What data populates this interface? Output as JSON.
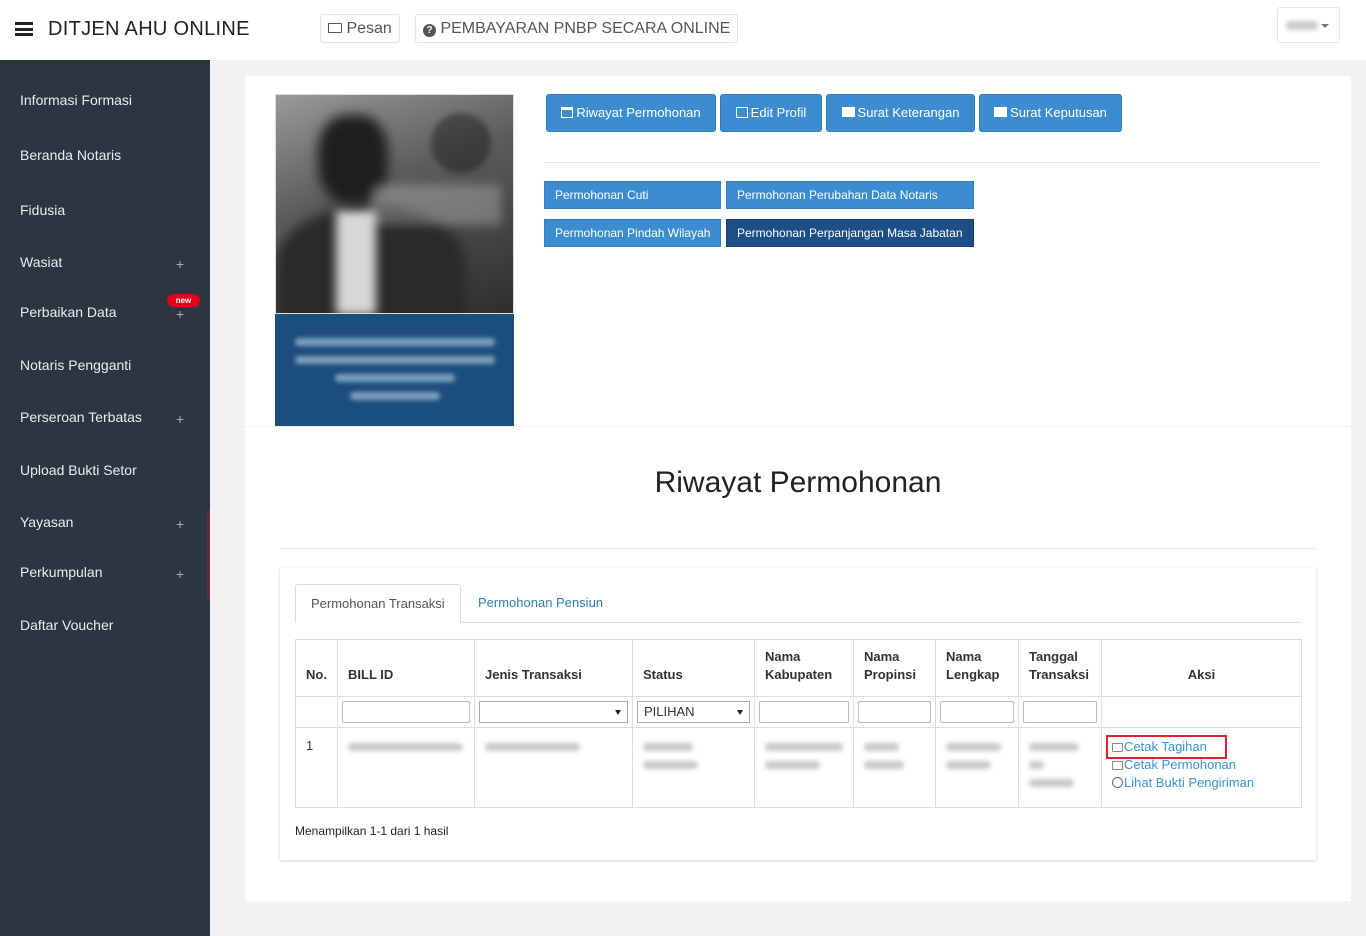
{
  "header": {
    "brand": "DITJEN AHU ONLINE",
    "pesan_label": "Pesan",
    "pnbp_label": "PEMBAYARAN PNBP SECARA ONLINE"
  },
  "sidebar": {
    "items": [
      {
        "label": "Informasi Formasi",
        "has_plus": false
      },
      {
        "label": "Beranda Notaris",
        "has_plus": false
      },
      {
        "label": "Fidusia",
        "has_plus": false
      },
      {
        "label": "Wasiat",
        "has_plus": true
      },
      {
        "label": "Perbaikan Data",
        "has_plus": true,
        "badge": "new"
      },
      {
        "label": "Notaris Pengganti",
        "has_plus": false
      },
      {
        "label": "Perseroan Terbatas",
        "has_plus": true
      },
      {
        "label": "Upload Bukti Setor",
        "has_plus": false
      },
      {
        "label": "Yayasan",
        "has_plus": true
      },
      {
        "label": "Perkumpulan",
        "has_plus": true
      },
      {
        "label": "Daftar Voucher",
        "has_plus": false
      }
    ],
    "plus_symbol": "+"
  },
  "profile_actions": {
    "riwayat": "Riwayat Permohonan",
    "edit_profil": "Edit Profil",
    "surat_keterangan": "Surat Keterangan",
    "surat_keputusan": "Surat Keputusan"
  },
  "requests": {
    "cuti": "Permohonan Cuti",
    "perubahan_data": "Permohonan Perubahan Data Notaris",
    "pindah_wilayah": "Permohonan Pindah Wilayah",
    "perpanjangan": "Permohonan Perpanjangan Masa Jabatan"
  },
  "main": {
    "title": "Riwayat Permohonan",
    "tabs": [
      {
        "label": "Permohonan Transaksi",
        "active": true
      },
      {
        "label": "Permohonan Pensiun",
        "active": false
      }
    ],
    "table": {
      "headers": {
        "no": "No.",
        "bill_id": "BILL ID",
        "jenis": "Jenis Transaksi",
        "status": "Status",
        "kabupaten": "Nama Kabupaten",
        "propinsi": "Nama Propinsi",
        "lengkap": "Nama Lengkap",
        "tanggal": "Tanggal Transaksi",
        "aksi": "Aksi"
      },
      "status_filter": "PILIHAN",
      "rows": [
        {
          "no": "1"
        }
      ],
      "actions": {
        "cetak_tagihan": "Cetak Tagihan",
        "cetak_permohonan": "Cetak Permohonan",
        "lihat_bukti": "Lihat Bukti Pengiriman"
      }
    },
    "result_text": "Menampilkan 1-1 dari 1 hasil"
  },
  "colors": {
    "sidebar_bg": "#2b3640",
    "primary": "#3c8dd0",
    "dark_primary": "#1d4f86",
    "highlight": "#d9232d"
  }
}
